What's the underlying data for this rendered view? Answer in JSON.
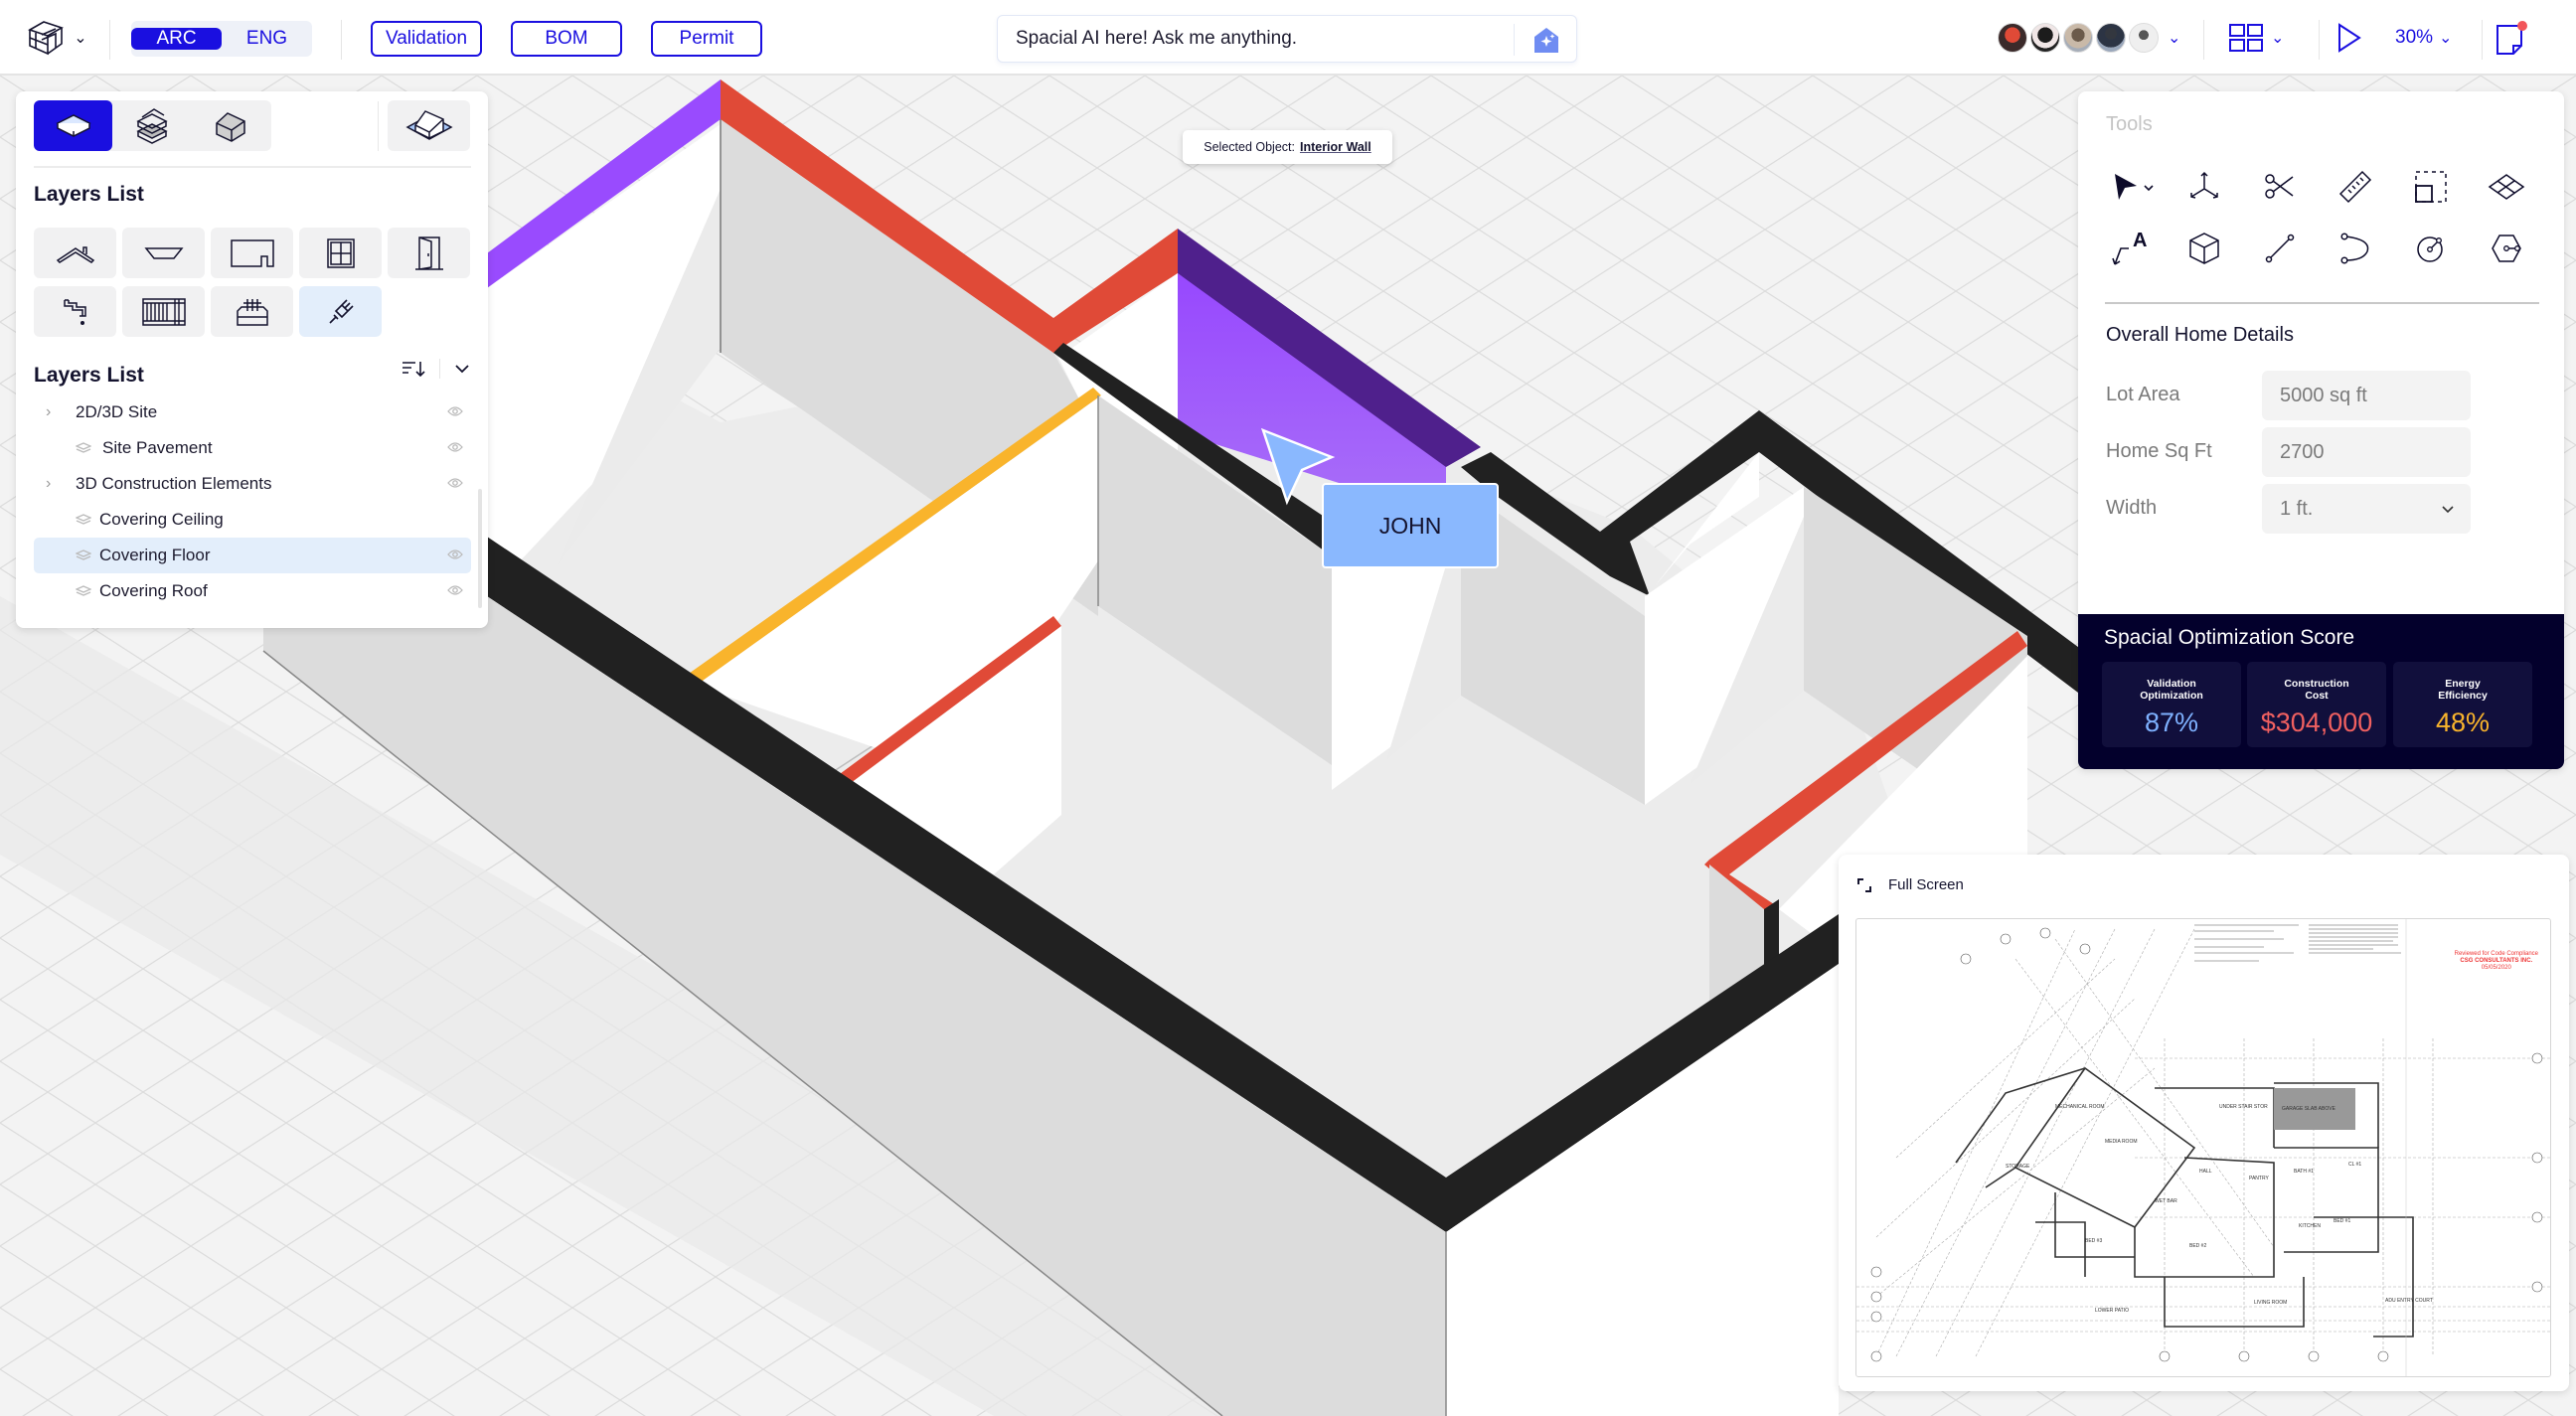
{
  "topbar": {
    "discipline_tabs": [
      {
        "label": "ARC",
        "active": true
      },
      {
        "label": "ENG",
        "active": false
      }
    ],
    "buttons": [
      {
        "label": "Validation"
      },
      {
        "label": "BOM"
      },
      {
        "label": "Permit"
      }
    ],
    "ai_prompt": {
      "placeholder": "Spacial AI here! Ask me anything.",
      "icon": "ai-house-sparkle-icon"
    },
    "collaborators": [
      {
        "name": "collaborator-1",
        "color": "#d24a3a"
      },
      {
        "name": "collaborator-2",
        "color": "#2b2b2b"
      },
      {
        "name": "collaborator-3",
        "color": "#9a8f86"
      },
      {
        "name": "collaborator-4",
        "color": "#5f6b7d"
      },
      {
        "name": "collaborator-5",
        "color": "#d9d9d9"
      }
    ],
    "zoom_level": "30%",
    "accent_color": "#1a0fe0",
    "notification_dot_color": "#f2555a"
  },
  "left_panel": {
    "view_modes": [
      {
        "icon": "floor-slab-icon",
        "active": true
      },
      {
        "icon": "stacked-floors-icon",
        "active": false
      },
      {
        "icon": "house-3d-icon",
        "active": false
      }
    ],
    "site_view_icon": "house-on-site-icon",
    "components_title": "Layers List",
    "components": [
      {
        "icon": "roof-icon"
      },
      {
        "icon": "ceiling-icon"
      },
      {
        "icon": "wall-icon"
      },
      {
        "icon": "window-icon"
      },
      {
        "icon": "door-icon"
      },
      {
        "icon": "plumbing-faucet-icon"
      },
      {
        "icon": "railing-icon"
      },
      {
        "icon": "heating-icon"
      },
      {
        "icon": "electrical-plug-icon",
        "active": true
      }
    ],
    "layers_title": "Layers List",
    "layers": [
      {
        "label": "2D/3D Site",
        "type": "group",
        "visible": true,
        "selected": false
      },
      {
        "label": "Site Pavement",
        "type": "layer",
        "visible": true,
        "selected": false
      },
      {
        "label": "3D Construction Elements",
        "type": "group",
        "visible": true,
        "selected": false
      },
      {
        "label": "Covering Ceiling",
        "type": "layer",
        "visible": false,
        "selected": false
      },
      {
        "label": "Covering Floor",
        "type": "layer",
        "visible": true,
        "selected": true
      },
      {
        "label": "Covering Roof",
        "type": "layer",
        "visible": true,
        "selected": false
      }
    ]
  },
  "selection": {
    "label": "Selected Object:",
    "value": "Interior Wall"
  },
  "cursor_user": {
    "name": "JOHN",
    "color": "#8ab8fe"
  },
  "right_panel": {
    "tools_title": "Tools",
    "tools": [
      {
        "icon": "select-pointer-icon"
      },
      {
        "icon": "move-axes-icon"
      },
      {
        "icon": "scissors-icon"
      },
      {
        "icon": "ruler-icon"
      },
      {
        "icon": "scale-box-icon"
      },
      {
        "icon": "grid-plane-icon"
      },
      {
        "icon": "text-annotation-icon"
      },
      {
        "icon": "cube-icon"
      },
      {
        "icon": "line-icon"
      },
      {
        "icon": "arc-icon"
      },
      {
        "icon": "circle-radius-icon"
      },
      {
        "icon": "polygon-icon"
      }
    ],
    "details_title": "Overall Home Details",
    "fields": [
      {
        "label": "Lot Area",
        "value": "5000 sq ft",
        "type": "text"
      },
      {
        "label": "Home Sq Ft",
        "value": "2700",
        "type": "text"
      },
      {
        "label": "Width",
        "value": "1 ft.",
        "type": "select"
      }
    ],
    "score": {
      "title": "Spacial Optimization Score",
      "cards": [
        {
          "label_line1": "Validation",
          "label_line2": "Optimization",
          "value": "87%",
          "color": "#7eb1ff"
        },
        {
          "label_line1": "Construction",
          "label_line2": "Cost",
          "value": "$304,000",
          "color": "#f06060"
        },
        {
          "label_line1": "Energy",
          "label_line2": "Efficiency",
          "value": "48%",
          "color": "#f9b42c"
        }
      ]
    }
  },
  "blueprint_panel": {
    "fullscreen_label": "Full Screen",
    "stamp_line1": "Reviewed for Code Compliance",
    "stamp_line2": "CSG CONSULTANTS INC.",
    "stamp_line3": "05/05/2020",
    "room_labels": [
      "MECHANICAL ROOM",
      "STORAGE",
      "MEDIA ROOM",
      "WET BAR",
      "BED #3",
      "BED #2",
      "LIVING ROOM",
      "KITCHEN",
      "BED #1",
      "BATH #1",
      "CL #1",
      "PANTRY",
      "UNDER STAIR STOR",
      "GARAGE SLAB ABOVE",
      "HALL",
      "LOWER PATIO",
      "ADU ENTRY COURT"
    ]
  },
  "scene_colors": {
    "wall_top_black": "#212121",
    "wall_top_red": "#e04a37",
    "wall_top_purple": "#994bfe",
    "wall_top_deep_purple": "#4f208c",
    "wall_top_yellow": "#f9b42c",
    "wall_face_light": "#dcdcdc",
    "wall_face_white": "#ffffff",
    "floor": "#ececec"
  }
}
